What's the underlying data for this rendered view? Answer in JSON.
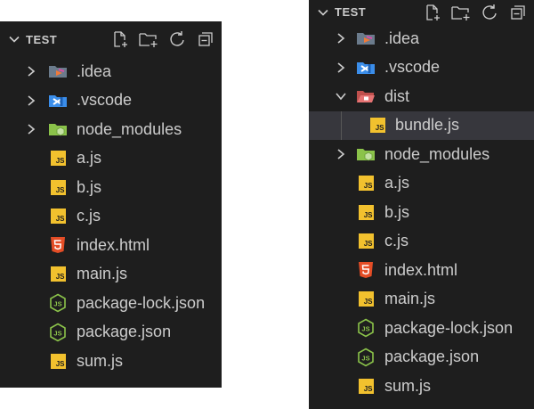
{
  "left": {
    "title": "TEST",
    "rows": [
      {
        "label": ".idea"
      },
      {
        "label": ".vscode"
      },
      {
        "label": "node_modules"
      },
      {
        "label": "a.js",
        "badge": "JS"
      },
      {
        "label": "b.js",
        "badge": "JS"
      },
      {
        "label": "c.js",
        "badge": "JS"
      },
      {
        "label": "index.html"
      },
      {
        "label": "main.js",
        "badge": "JS"
      },
      {
        "label": "package-lock.json"
      },
      {
        "label": "package.json"
      },
      {
        "label": "sum.js",
        "badge": "JS"
      }
    ]
  },
  "right": {
    "title": "TEST",
    "rows": [
      {
        "label": ".idea"
      },
      {
        "label": ".vscode"
      },
      {
        "label": "dist"
      },
      {
        "label": "bundle.js",
        "badge": "JS"
      },
      {
        "label": "node_modules"
      },
      {
        "label": "a.js",
        "badge": "JS"
      },
      {
        "label": "b.js",
        "badge": "JS"
      },
      {
        "label": "c.js",
        "badge": "JS"
      },
      {
        "label": "index.html"
      },
      {
        "label": "main.js",
        "badge": "JS"
      },
      {
        "label": "package-lock.json"
      },
      {
        "label": "package.json"
      },
      {
        "label": "sum.js",
        "badge": "JS"
      }
    ]
  },
  "colors": {
    "background": "#1e1e1e",
    "text": "#cccccc",
    "selected_row": "#37373d",
    "js_icon": "#f2c12e",
    "html_icon": "#e44d26",
    "json_icon": "#8bc34a",
    "node_folder": "#8bc34a",
    "vscode_icon": "#3b8eea",
    "dist_folder": "#e57373"
  }
}
